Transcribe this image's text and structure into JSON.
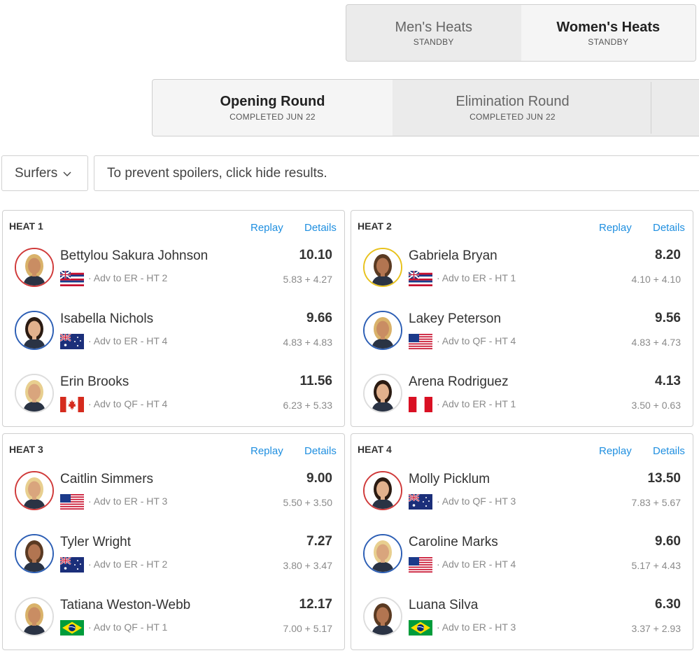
{
  "gender_tabs": [
    {
      "label": "Men's Heats",
      "status": "STANDBY",
      "active": false
    },
    {
      "label": "Women's Heats",
      "status": "STANDBY",
      "active": true
    }
  ],
  "round_tabs": [
    {
      "label": "Opening Round",
      "status": "COMPLETED JUN 22",
      "active": true
    },
    {
      "label": "Elimination Round",
      "status": "COMPLETED JUN 22",
      "active": false
    }
  ],
  "filter": {
    "surfers_label": "Surfers",
    "spoiler_text": "To prevent spoilers, click hide results."
  },
  "links": {
    "replay": "Replay",
    "details": "Details"
  },
  "heats": [
    {
      "title": "HEAT 1",
      "surfers": [
        {
          "name": "Bettylou Sakura Johnson",
          "flag": "hawaii",
          "result": "· Adv to ER - HT 2",
          "total": "10.10",
          "waves": "5.83 + 4.27",
          "ring": "#d03a3a"
        },
        {
          "name": "Isabella Nichols",
          "flag": "australia",
          "result": "· Adv to ER - HT 4",
          "total": "9.66",
          "waves": "4.83 + 4.83",
          "ring": "#2d5fb5"
        },
        {
          "name": "Erin Brooks",
          "flag": "canada",
          "result": "· Adv to QF - HT 4",
          "total": "11.56",
          "waves": "6.23 + 5.33",
          "ring": "#dddddd"
        }
      ]
    },
    {
      "title": "HEAT 2",
      "surfers": [
        {
          "name": "Gabriela Bryan",
          "flag": "hawaii",
          "result": "· Adv to ER - HT 1",
          "total": "8.20",
          "waves": "4.10 + 4.10",
          "ring": "#e8c21c"
        },
        {
          "name": "Lakey Peterson",
          "flag": "usa",
          "result": "· Adv to QF - HT 4",
          "total": "9.56",
          "waves": "4.83 + 4.73",
          "ring": "#2d5fb5"
        },
        {
          "name": "Arena Rodriguez",
          "flag": "peru",
          "result": "· Adv to ER - HT 1",
          "total": "4.13",
          "waves": "3.50 + 0.63",
          "ring": "#dddddd"
        }
      ]
    },
    {
      "title": "HEAT 3",
      "surfers": [
        {
          "name": "Caitlin Simmers",
          "flag": "usa",
          "result": "· Adv to ER - HT 3",
          "total": "9.00",
          "waves": "5.50 + 3.50",
          "ring": "#d03a3a"
        },
        {
          "name": "Tyler Wright",
          "flag": "australia",
          "result": "· Adv to ER - HT 2",
          "total": "7.27",
          "waves": "3.80 + 3.47",
          "ring": "#2d5fb5"
        },
        {
          "name": "Tatiana Weston-Webb",
          "flag": "brazil",
          "result": "· Adv to QF - HT 1",
          "total": "12.17",
          "waves": "7.00 + 5.17",
          "ring": "#dddddd"
        }
      ]
    },
    {
      "title": "HEAT 4",
      "surfers": [
        {
          "name": "Molly Picklum",
          "flag": "australia",
          "result": "· Adv to QF - HT 3",
          "total": "13.50",
          "waves": "7.83 + 5.67",
          "ring": "#d03a3a"
        },
        {
          "name": "Caroline Marks",
          "flag": "usa",
          "result": "· Adv to ER - HT 4",
          "total": "9.60",
          "waves": "5.17 + 4.43",
          "ring": "#2d5fb5"
        },
        {
          "name": "Luana Silva",
          "flag": "brazil",
          "result": "· Adv to ER - HT 3",
          "total": "6.30",
          "waves": "3.37 + 2.93",
          "ring": "#dddddd"
        }
      ]
    }
  ]
}
